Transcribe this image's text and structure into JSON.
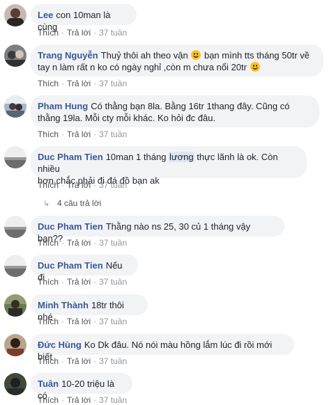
{
  "common": {
    "like_label": "Thích",
    "reply_label": "Trả lời",
    "separator": "·"
  },
  "comments": [
    {
      "author": "Lee",
      "text": "con 10man là cùng",
      "time": "37 tuần"
    },
    {
      "author": "Trang Nguyễn",
      "text_1": "Thuỷ thôi ah theo vận",
      "text_2": "bạn mình tts tháng 50tr về",
      "text_3": "tay n làm rất n ko có ngày nghỉ ,còn m chưa nổi 20tr",
      "time": "37 tuần"
    },
    {
      "author": "Pham Hung",
      "line_1": "Có thằng bạn 8la. Bằng 16tr 1thang đây. Cũng có",
      "line_2": "thằng 19la. Mỗi cty mỗi khác. Ko hỏi đc đâu.",
      "time": "37 tuần"
    },
    {
      "author": "Duc Pham Tien",
      "text_1": "10man 1 tháng",
      "highlight": "lương",
      "text_2": "thực lãnh là ok. Còn nhiều",
      "line_2": "hơn chắc phải đi đá đồ bạn ak",
      "time": "37 tuần",
      "replies_label": "4 câu trả lời"
    },
    {
      "author": "Duc Pham Tien",
      "text": "Thằng nào ns 25, 30 củ 1 tháng vậy bạn??",
      "time": "37 tuần"
    },
    {
      "author": "Duc Pham Tien",
      "text": "Nếu đi",
      "time": "37 tuần"
    },
    {
      "author": "Minh Thành",
      "text": "18tr thôi nhé",
      "time": "37 tuần"
    },
    {
      "author": "Đức Hùng",
      "text": "Ko Dk đâu. Nó nói màu hồng lắm lúc đi rồi mới biết",
      "time": "37 tuần"
    },
    {
      "author": "Tuân",
      "text": "10-20 triệu là có",
      "time": "37 tuần"
    }
  ],
  "colors": {
    "author": "#385898",
    "bubble_bg": "#f2f3f5",
    "meta": "#90949c",
    "emoji": "#f7c429"
  }
}
